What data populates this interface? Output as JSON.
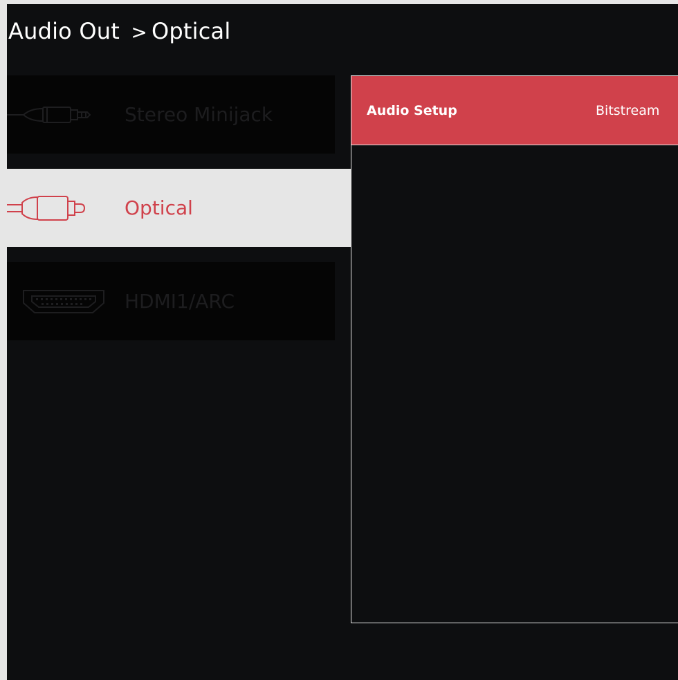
{
  "header": {
    "section": "Audio Out",
    "separator": ">",
    "current": "Optical"
  },
  "outputs": [
    {
      "label": "Stereo Minijack",
      "icon": "minijack-connector-icon",
      "selected": false
    },
    {
      "label": "Optical",
      "icon": "optical-connector-icon",
      "selected": true
    },
    {
      "label": "HDMI1/ARC",
      "icon": "hdmi-connector-icon",
      "selected": false
    }
  ],
  "settings_panel": {
    "rows": [
      {
        "name": "Audio Setup",
        "value": "Bitstream",
        "highlighted": true
      }
    ]
  },
  "colors": {
    "accent": "#d0414b",
    "background": "#0d0e10",
    "selected_row": "#e6e6e6",
    "unselected_row": "#050505"
  }
}
